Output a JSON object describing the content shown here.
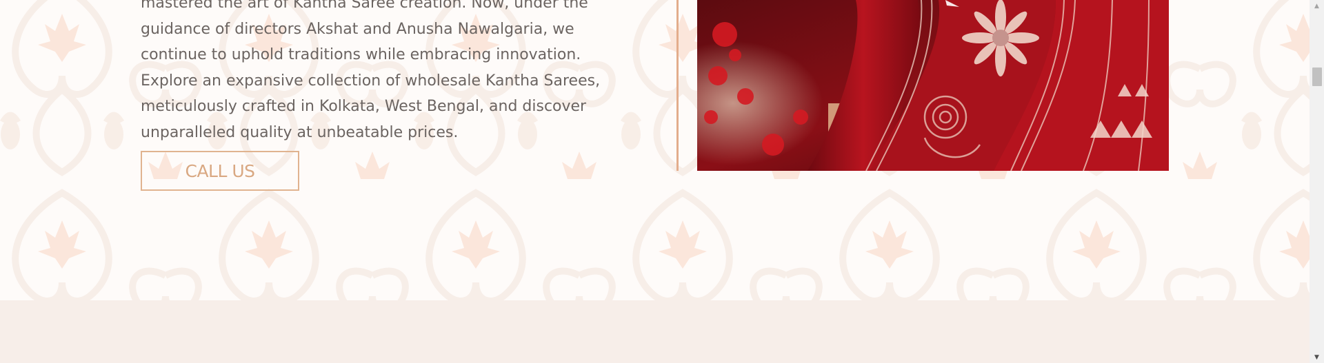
{
  "about": {
    "paragraph": "mastered the art of Kantha Saree creation. Now, under the guidance of directors Akshat and Anusha Nawalgaria, we continue to uphold traditions while embracing innovation. Explore an expansive collection of wholesale Kantha Sarees, meticulously crafted in Kolkata, West Bengal, and discover unparalleled quality at unbeatable prices.",
    "call_button_label": "CALL US"
  },
  "colors": {
    "accent": "#e0b38f",
    "button_text": "#d9a882",
    "body_text": "#6b6461",
    "footer_band": "#f7eee9",
    "saree_red": "#a4121b"
  },
  "scrollbar": {
    "up_icon": "triangle-up",
    "down_icon": "triangle-down"
  }
}
